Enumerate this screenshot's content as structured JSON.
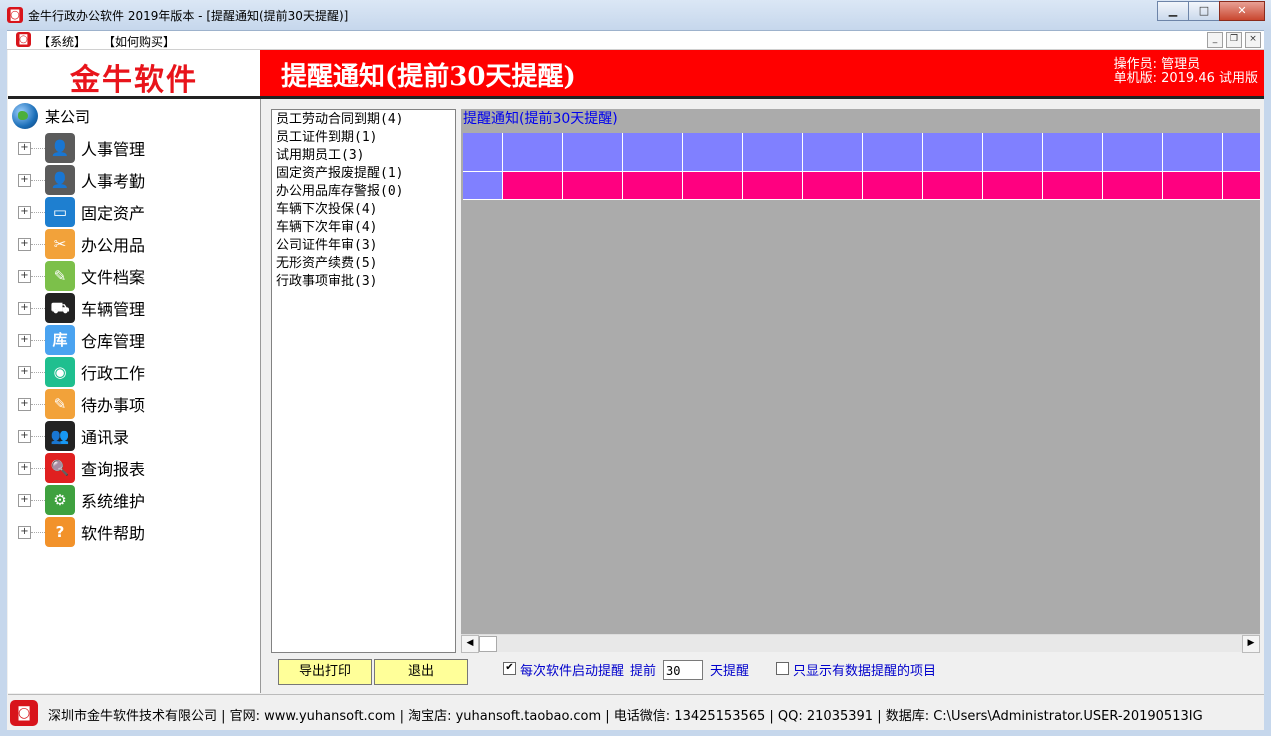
{
  "window": {
    "title": "金牛行政办公软件 2019年版本 - [提醒通知(提前30天提醒)]",
    "minimize": "▁",
    "maximize": "□",
    "close": "✕"
  },
  "menubar": {
    "items": [
      "【系统】",
      "【如何购买】"
    ],
    "mdi_minimize": "_",
    "mdi_restore": "❐",
    "mdi_close": "×"
  },
  "brand": {
    "name": "金牛软件"
  },
  "banner": {
    "title": "提醒通知(提前30天提醒)",
    "operator": "操作员: 管理员",
    "edition": "单机版: 2019.46 试用版"
  },
  "tree": {
    "root": "某公司",
    "items": [
      {
        "label": "人事管理",
        "icon": "person-icon",
        "color": "#5b5b5b",
        "glyph": "👤"
      },
      {
        "label": "人事考勤",
        "icon": "person-icon",
        "color": "#5b5b5b",
        "glyph": "👤"
      },
      {
        "label": "固定资产",
        "icon": "computer-icon",
        "color": "#1e7fd0",
        "glyph": "▭"
      },
      {
        "label": "办公用品",
        "icon": "scissors-icon",
        "color": "#f2a23a",
        "glyph": "✂"
      },
      {
        "label": "文件档案",
        "icon": "notebook-icon",
        "color": "#7cc04a",
        "glyph": "✎"
      },
      {
        "label": "车辆管理",
        "icon": "car-icon",
        "color": "#222222",
        "glyph": "⛟"
      },
      {
        "label": "仓库管理",
        "icon": "warehouse-icon",
        "color": "#4aa3f0",
        "glyph": "库"
      },
      {
        "label": "行政工作",
        "icon": "chat-icon",
        "color": "#1fbf8f",
        "glyph": "◉"
      },
      {
        "label": "待办事项",
        "icon": "note-icon",
        "color": "#f2a23a",
        "glyph": "✎"
      },
      {
        "label": "通讯录",
        "icon": "contacts-icon",
        "color": "#222222",
        "glyph": "👥"
      },
      {
        "label": "查询报表",
        "icon": "search-icon",
        "color": "#e02020",
        "glyph": "🔍"
      },
      {
        "label": "系统维护",
        "icon": "gear-icon",
        "color": "#3fa13f",
        "glyph": "⚙"
      },
      {
        "label": "软件帮助",
        "icon": "help-icon",
        "color": "#f2922a",
        "glyph": "?"
      }
    ]
  },
  "categories": [
    "员工劳动合同到期(4)",
    "员工证件到期(1)",
    "试用期员工(3)",
    "固定资产报废提醒(1)",
    "办公用品库存警报(0)",
    "车辆下次投保(4)",
    "车辆下次年审(4)",
    "公司证件年审(3)",
    "无形资产续费(5)",
    "行政事项审批(3)"
  ],
  "grid": {
    "caption": "提醒通知(提前30天提醒)",
    "header_color": "#8080ff",
    "row_color": "#ff0080",
    "selector_color": "#8080ff",
    "columns": 14
  },
  "buttons": {
    "export": "导出打印",
    "exit": "退出"
  },
  "options": {
    "startup_label": "每次软件启动提醒",
    "startup_checked": "✔",
    "advance_label": "提前",
    "days_value": "30",
    "days_suffix": "天提醒",
    "only_data_label": "只显示有数据提醒的项目"
  },
  "status": {
    "text": "深圳市金牛软件技术有限公司 | 官网: www.yuhansoft.com | 淘宝店: yuhansoft.taobao.com | 电话微信: 13425153565 | QQ: 21035391 | 数据库: C:\\Users\\Administrator.USER-20190513IG"
  }
}
